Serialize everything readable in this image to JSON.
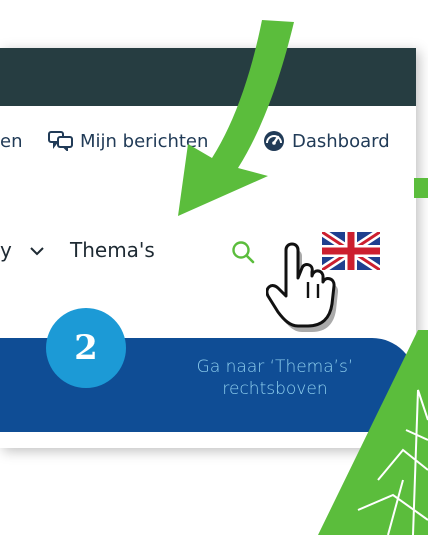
{
  "top_nav": {
    "truncated_item": "en",
    "messages_label": "Mijn berichten",
    "dashboard_label": "Dashboard"
  },
  "main_nav": {
    "truncated_dropdown_suffix": "y",
    "themes_label": "Thema's"
  },
  "step": {
    "number": "2",
    "line1": "Ga naar ‘Thema’s’",
    "line2": "rechtsboven"
  },
  "colors": {
    "topbar": "#263d41",
    "banner": "#0f4d95",
    "badge": "#1c9ad6",
    "arrow": "#5bbd3c",
    "banner_text": "#8fd0ef"
  },
  "icons": [
    "chat-icon",
    "dashboard-icon",
    "chevron-down-icon",
    "search-icon",
    "uk-flag-icon",
    "hand-pointer-icon",
    "arrow-icon"
  ]
}
